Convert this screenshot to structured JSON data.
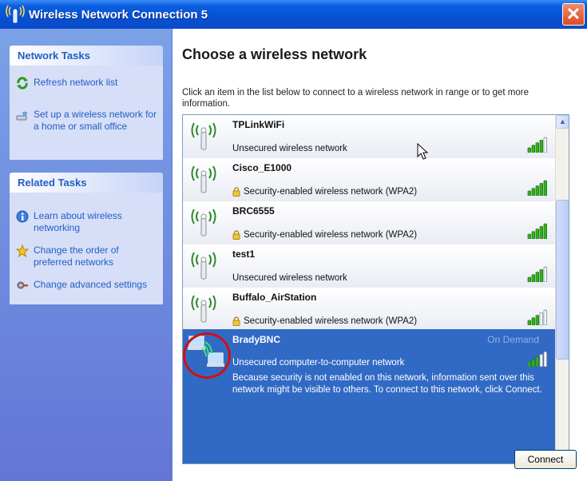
{
  "window": {
    "title": "Wireless Network Connection 5",
    "close_glyph": "✕"
  },
  "sidebar": {
    "network_tasks": {
      "heading": "Network Tasks",
      "items": [
        {
          "label": "Refresh network list",
          "icon": "refresh-icon"
        },
        {
          "label": "Set up a wireless network for a home or small office",
          "icon": "setup-wireless-icon"
        }
      ]
    },
    "related_tasks": {
      "heading": "Related Tasks",
      "items": [
        {
          "label": "Learn about wireless networking",
          "icon": "info-icon"
        },
        {
          "label": "Change the order of preferred networks",
          "icon": "star-icon"
        },
        {
          "label": "Change advanced settings",
          "icon": "settings-icon"
        }
      ]
    }
  },
  "main": {
    "heading": "Choose a wireless network",
    "description": "Click an item in the list below to connect to a wireless network in range or to get more information.",
    "networks": [
      {
        "name": "TPLinkWiFi",
        "security": "Unsecured wireless network",
        "secured": false,
        "signal": 4
      },
      {
        "name": "Cisco_E1000",
        "security": "Security-enabled wireless network (WPA2)",
        "secured": true,
        "signal": 5
      },
      {
        "name": "BRC6555",
        "security": "Security-enabled wireless network (WPA2)",
        "secured": true,
        "signal": 5
      },
      {
        "name": "test1",
        "security": "Unsecured wireless network",
        "secured": false,
        "signal": 4
      },
      {
        "name": "Buffalo_AirStation",
        "security": "Security-enabled wireless network (WPA2)",
        "secured": true,
        "signal": 3
      }
    ],
    "selected": {
      "name": "BradyBNC",
      "status": "On Demand",
      "security": "Unsecured computer-to-computer network",
      "note": "Because security is not enabled on this network, information sent over this network might be visible to others. To connect to this network, click Connect.",
      "signal": 3
    },
    "connect_label": "Connect"
  },
  "colors": {
    "title_bar": "#0651d4",
    "selection": "#316ac5",
    "sidebar_link": "#215dc6",
    "highlight_circle": "#d01010"
  }
}
